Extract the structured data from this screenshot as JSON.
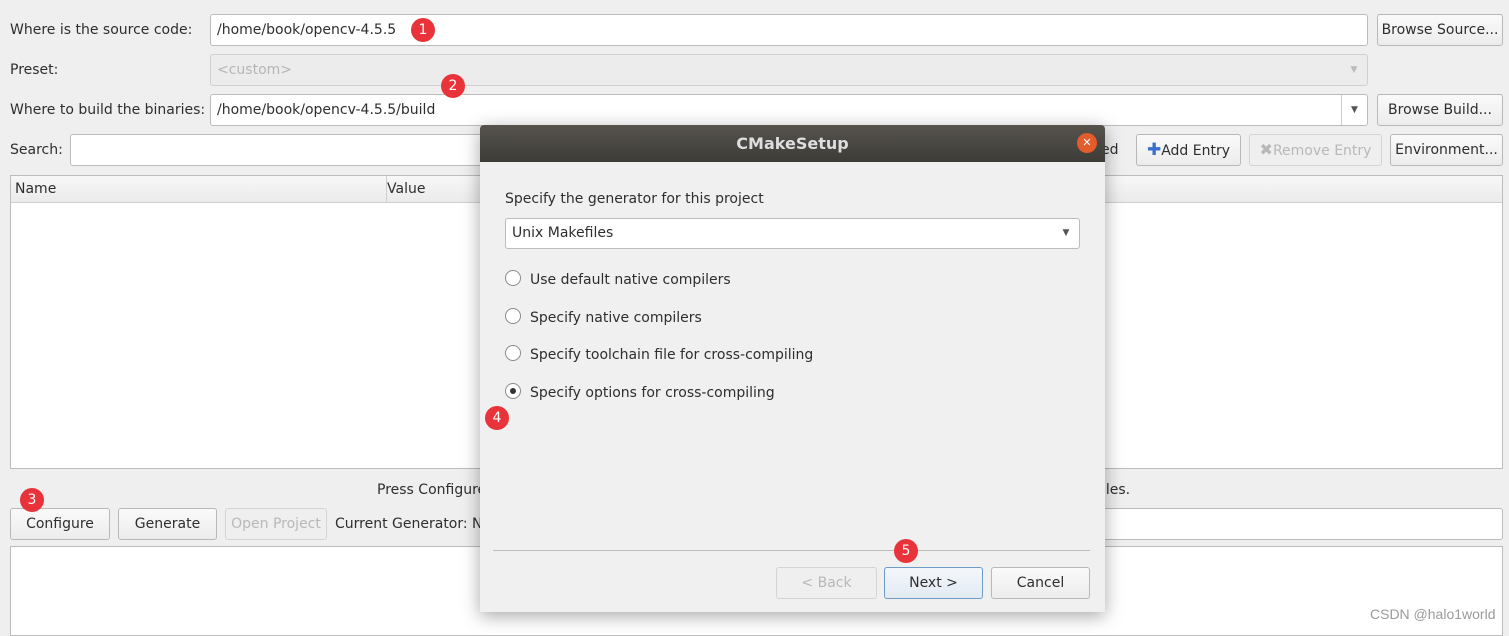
{
  "main": {
    "source_label": "Where is the source code:",
    "source_value": "/home/book/opencv-4.5.5",
    "browse_source": "Browse Source...",
    "preset_label": "Preset:",
    "preset_value": "<custom>",
    "build_label": "Where to build the binaries:",
    "build_value": "/home/book/opencv-4.5.5/build",
    "browse_build": "Browse Build...",
    "search_label": "Search:",
    "search_value": "",
    "grouped_fragment": "ed",
    "add_entry": "Add Entry",
    "remove_entry": "Remove Entry",
    "environment": "Environment...",
    "table_headers": [
      "Name",
      "Value"
    ],
    "status_left": "Press Configure",
    "status_right": "files.",
    "configure": "Configure",
    "generate": "Generate",
    "open_project": "Open Project",
    "current_generator": "Current Generator: N"
  },
  "dialog": {
    "title": "CMakeSetup",
    "prompt": "Specify the generator for this project",
    "generator": "Unix Makefiles",
    "options": [
      {
        "label": "Use default native compilers",
        "checked": false
      },
      {
        "label": "Specify native compilers",
        "checked": false
      },
      {
        "label": "Specify toolchain file for cross-compiling",
        "checked": false
      },
      {
        "label": "Specify options for cross-compiling",
        "checked": true
      }
    ],
    "back": "< Back",
    "next": "Next >",
    "cancel": "Cancel"
  },
  "badges": [
    "1",
    "2",
    "3",
    "4",
    "5"
  ],
  "badge_color": "#e8333a",
  "watermark": "CSDN @halo1world"
}
